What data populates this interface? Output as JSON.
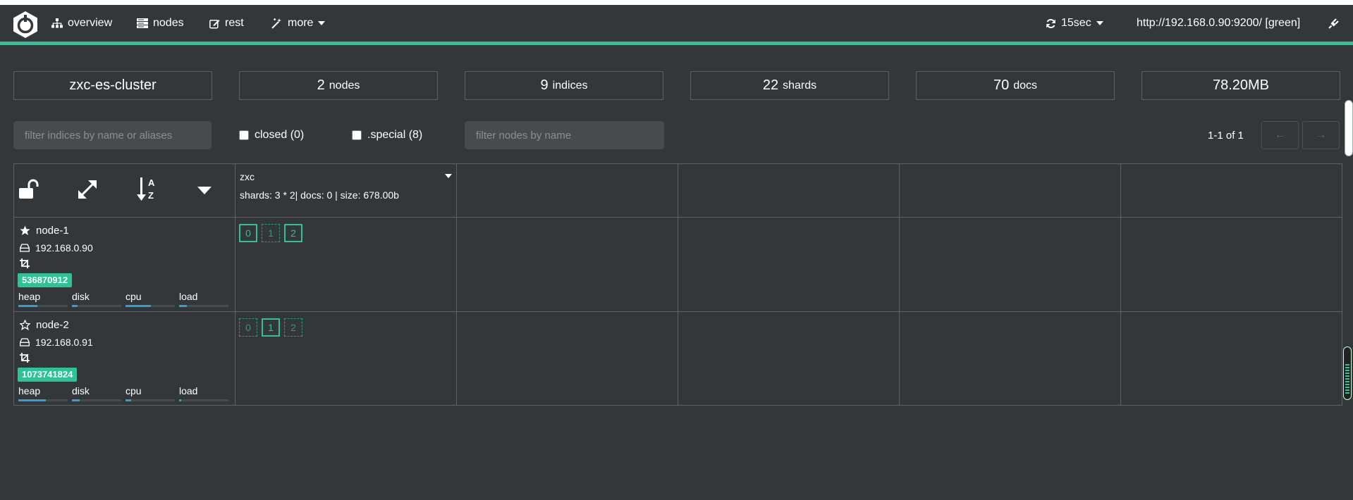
{
  "nav": {
    "overview": "overview",
    "nodes": "nodes",
    "rest": "rest",
    "more": "more",
    "refresh": "15sec",
    "connection": "http://192.168.0.90:9200/ [green]"
  },
  "stats": {
    "cluster_name": "zxc-es-cluster",
    "nodes_count": "2",
    "nodes_label": "nodes",
    "indices_count": "9",
    "indices_label": "indices",
    "shards_count": "22",
    "shards_label": "shards",
    "docs_count": "70",
    "docs_label": "docs",
    "size": "78.20MB"
  },
  "filters": {
    "indices_placeholder": "filter indices by name or aliases",
    "closed_label": "closed (0)",
    "special_label": ".special (8)",
    "nodes_placeholder": "filter nodes by name",
    "pagination": "1-1 of 1",
    "prev": "←",
    "next": "→"
  },
  "index": {
    "name": "zxc",
    "info": "shards: 3 * 2| docs: 0 | size: 678.00b"
  },
  "nodes": [
    {
      "name": "node-1",
      "ip": "192.168.0.90",
      "badge": "536870912",
      "master": true,
      "metrics": {
        "heap": "heap",
        "disk": "disk",
        "cpu": "cpu",
        "load": "load"
      },
      "levels": {
        "heap": 0.38,
        "disk": 0.12,
        "cpu": 0.52,
        "load": 0.16
      },
      "shards": [
        {
          "n": "0",
          "kind": "primary"
        },
        {
          "n": "1",
          "kind": "replica"
        },
        {
          "n": "2",
          "kind": "primary"
        }
      ]
    },
    {
      "name": "node-2",
      "ip": "192.168.0.91",
      "badge": "1073741824",
      "master": false,
      "metrics": {
        "heap": "heap",
        "disk": "disk",
        "cpu": "cpu",
        "load": "load"
      },
      "levels": {
        "heap": 0.55,
        "disk": 0.15,
        "cpu": 0.12,
        "load": 0.04
      },
      "shards": [
        {
          "n": "0",
          "kind": "replica"
        },
        {
          "n": "1",
          "kind": "primary"
        },
        {
          "n": "2",
          "kind": "replica"
        }
      ]
    }
  ],
  "colors": {
    "accent": "#2ec298",
    "background": "#33373a",
    "bar": "#2d9fd9"
  }
}
